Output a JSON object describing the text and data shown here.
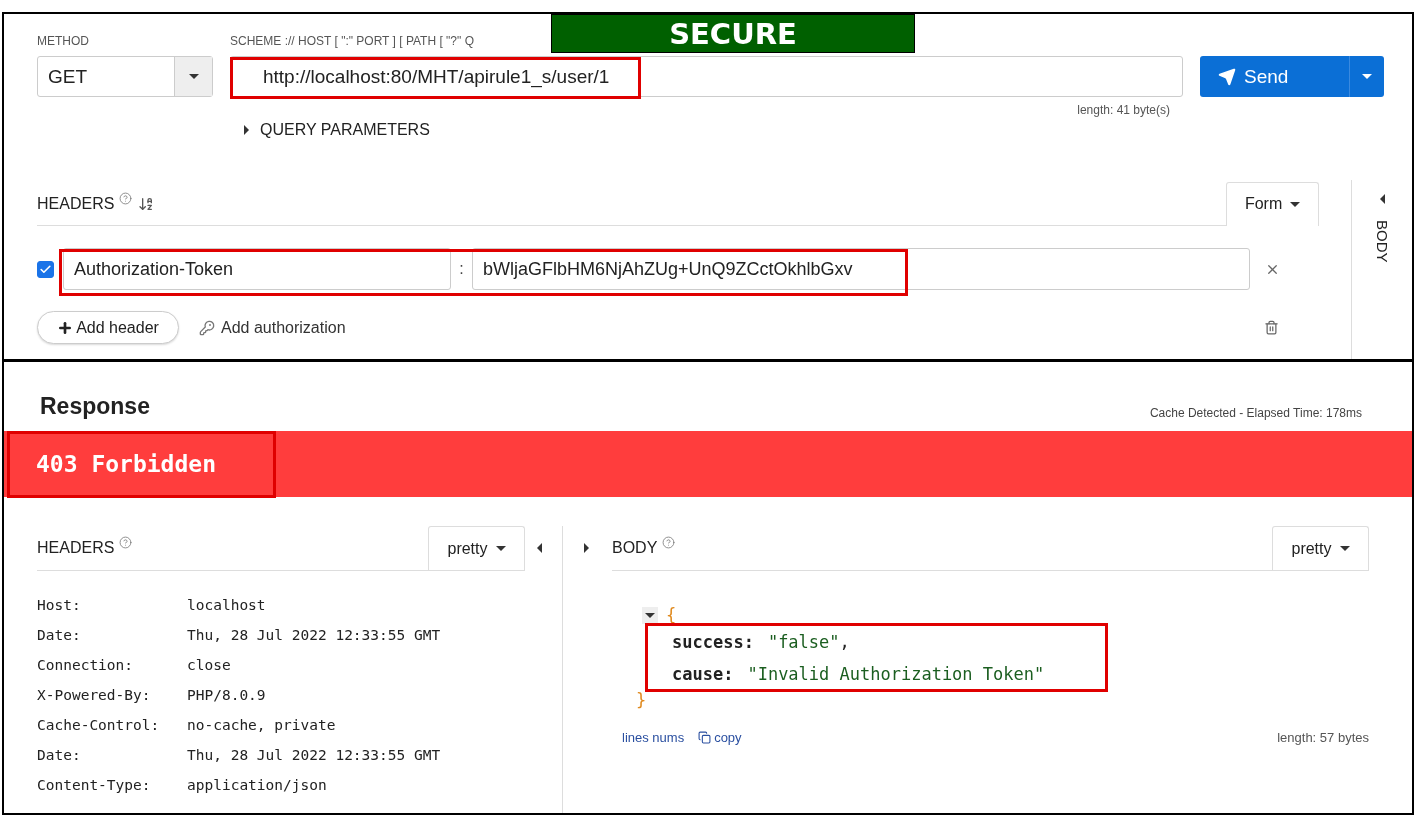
{
  "banner": {
    "text": "SECURE"
  },
  "request": {
    "method_label": "METHOD",
    "method": "GET",
    "url_label": "SCHEME :// HOST [ \":\" PORT ] [ PATH [ \"?\" Q",
    "url": "http://localhost:80/MHT/apirule1_s/user/1",
    "url_highlighted": true,
    "send_label": "Send",
    "url_length": "length: 41 byte(s)",
    "query_parameters": {
      "label": "QUERY PARAMETERS",
      "expanded": false
    }
  },
  "request_headers": {
    "title": "HEADERS",
    "mode": "Form",
    "rows": [
      {
        "enabled": true,
        "key": "Authorization-Token",
        "separator": ":",
        "value": "bWljaGFlbHM6NjAhZUg+UnQ9ZCctOkhlbGxv",
        "highlighted": true
      }
    ],
    "add_header": "Add header",
    "add_authorization": "Add authorization",
    "body_tab": {
      "label": "BODY",
      "expanded": false
    }
  },
  "response": {
    "title": "Response",
    "timing": "Cache Detected - Elapsed Time: 178ms",
    "status": {
      "text": "403 Forbidden",
      "highlighted": true
    },
    "headers": {
      "title": "HEADERS",
      "format": "pretty",
      "expanded": true,
      "items": [
        {
          "name": "Host:",
          "value": "localhost"
        },
        {
          "name": "Date:",
          "value": "Thu, 28 Jul 2022 12:33:55 GMT"
        },
        {
          "name": "Connection:",
          "value": "close"
        },
        {
          "name": "X-Powered-By:",
          "value": "PHP/8.0.9"
        },
        {
          "name": "Cache-Control:",
          "value": "no-cache, private"
        },
        {
          "name": "Date:",
          "value": "Thu, 28 Jul 2022 12:33:55 GMT"
        },
        {
          "name": "Content-Type:",
          "value": "application/json"
        }
      ]
    },
    "body": {
      "title": "BODY",
      "format": "pretty",
      "expanded": true,
      "open_brace": "{",
      "close_brace": "}",
      "highlighted": true,
      "fields": [
        {
          "key": "success:",
          "value": "\"false\"",
          "separator": ","
        },
        {
          "key": "cause:",
          "value": "\"Invalid Authorization Token\""
        }
      ],
      "line_numbers": "lines nums",
      "copy": "copy",
      "length": "length: 57 bytes"
    }
  }
}
